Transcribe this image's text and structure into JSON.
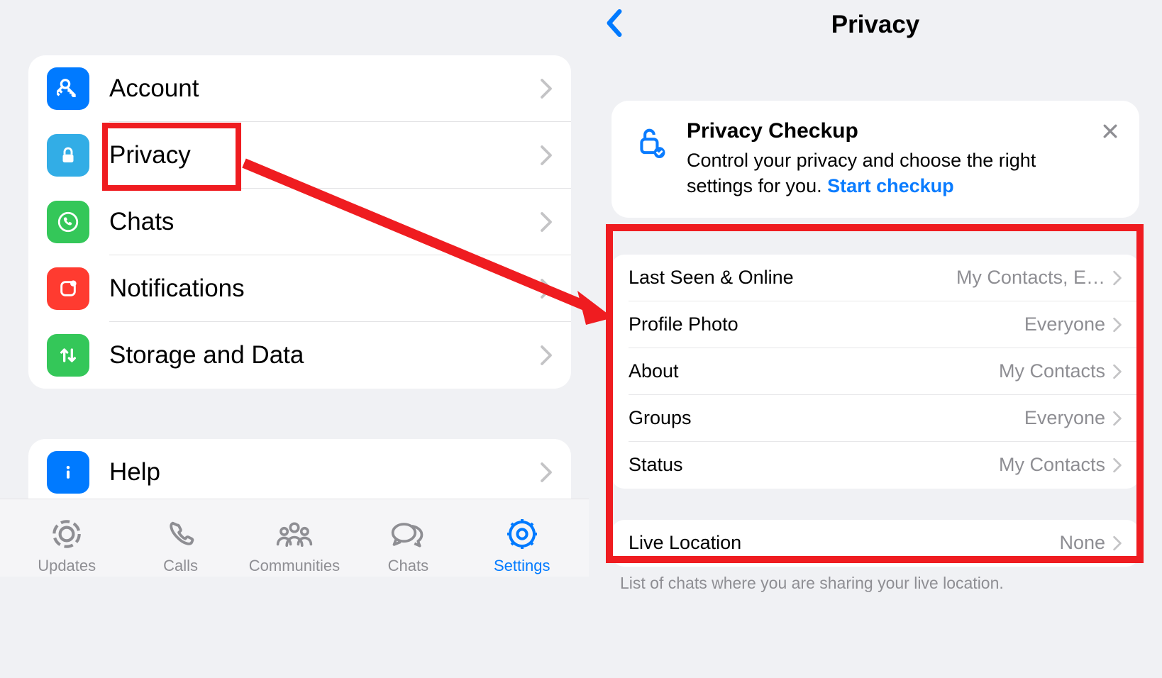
{
  "settings": {
    "items": [
      {
        "label": "Account",
        "icon": "key",
        "color": "#007aff"
      },
      {
        "label": "Privacy",
        "icon": "lock",
        "color": "#32ade6"
      },
      {
        "label": "Chats",
        "icon": "whatsapp",
        "color": "#34c759"
      },
      {
        "label": "Notifications",
        "icon": "notification",
        "color": "#ff3b30"
      },
      {
        "label": "Storage and Data",
        "icon": "updown",
        "color": "#34c759"
      }
    ],
    "help": {
      "label": "Help",
      "icon": "info",
      "color": "#007aff"
    }
  },
  "tabs": [
    {
      "label": "Updates",
      "icon": "updates"
    },
    {
      "label": "Calls",
      "icon": "calls"
    },
    {
      "label": "Communities",
      "icon": "communities"
    },
    {
      "label": "Chats",
      "icon": "chats"
    },
    {
      "label": "Settings",
      "icon": "settings",
      "active": true
    }
  ],
  "privacy": {
    "header_title": "Privacy",
    "checkup": {
      "title": "Privacy Checkup",
      "desc_prefix": "Control your privacy and choose the right settings for you. ",
      "link": "Start checkup"
    },
    "group1": [
      {
        "label": "Last Seen & Online",
        "value": "My Contacts, E…"
      },
      {
        "label": "Profile Photo",
        "value": "Everyone"
      },
      {
        "label": "About",
        "value": "My Contacts"
      },
      {
        "label": "Groups",
        "value": "Everyone"
      },
      {
        "label": "Status",
        "value": "My Contacts"
      }
    ],
    "group2": [
      {
        "label": "Live Location",
        "value": "None"
      }
    ],
    "footer": "List of chats where you are sharing your live location."
  }
}
